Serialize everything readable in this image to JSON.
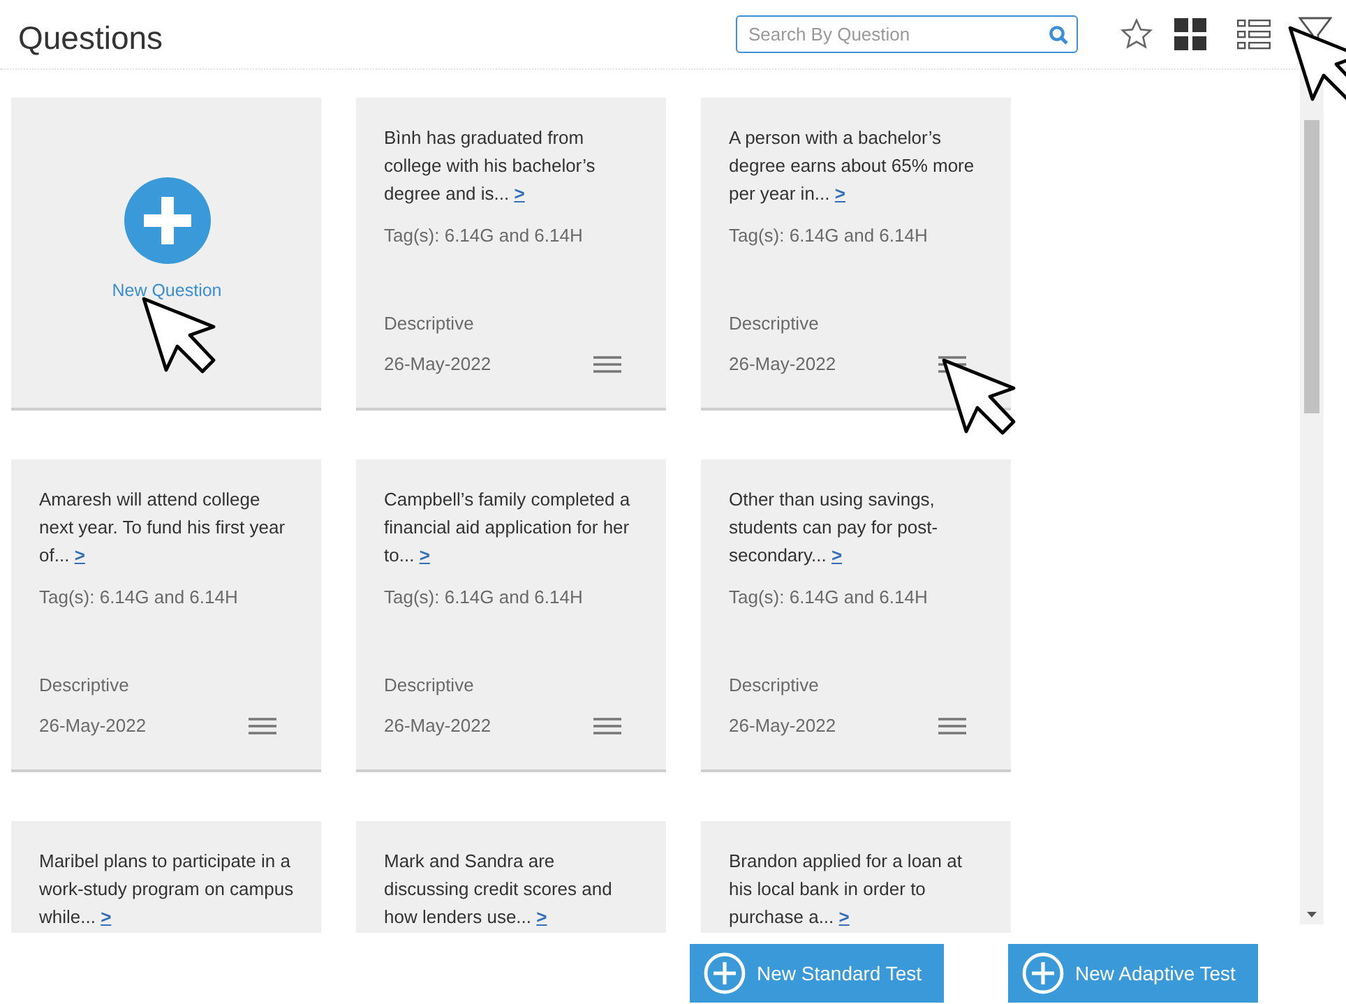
{
  "header": {
    "title": "Questions",
    "search": {
      "placeholder": "Search By Question"
    }
  },
  "new_question": {
    "label": "New Question"
  },
  "questions": [
    {
      "text": "Bình has graduated from college with his bachelor’s degree and is...",
      "more": ">",
      "tags": "Tag(s): 6.14G and 6.14H",
      "type": "Descriptive",
      "date": "26-May-2022"
    },
    {
      "text": "A person with a bachelor’s degree earns about 65% more per year in...",
      "more": ">",
      "tags": "Tag(s): 6.14G and 6.14H",
      "type": "Descriptive",
      "date": "26-May-2022"
    },
    {
      "text": "Amaresh will attend college next year. To fund his first year of...",
      "more": ">",
      "tags": "Tag(s): 6.14G and 6.14H",
      "type": "Descriptive",
      "date": "26-May-2022"
    },
    {
      "text": "Campbell’s family completed a financial aid application for her to...",
      "more": ">",
      "tags": "Tag(s): 6.14G and 6.14H",
      "type": "Descriptive",
      "date": "26-May-2022"
    },
    {
      "text": "Other than using savings, students can pay for post-secondary...",
      "more": ">",
      "tags": "Tag(s): 6.14G and 6.14H",
      "type": "Descriptive",
      "date": "26-May-2022"
    },
    {
      "text": "Maribel plans to participate in a work-study program on campus while...",
      "more": ">"
    },
    {
      "text": "Mark and Sandra are discussing credit scores and how lenders use...",
      "more": ">"
    },
    {
      "text": "Brandon applied for a loan at his local bank in order to purchase a...",
      "more": ">"
    }
  ],
  "footer_buttons": [
    "New Standard Test",
    "New Adaptive Test"
  ]
}
